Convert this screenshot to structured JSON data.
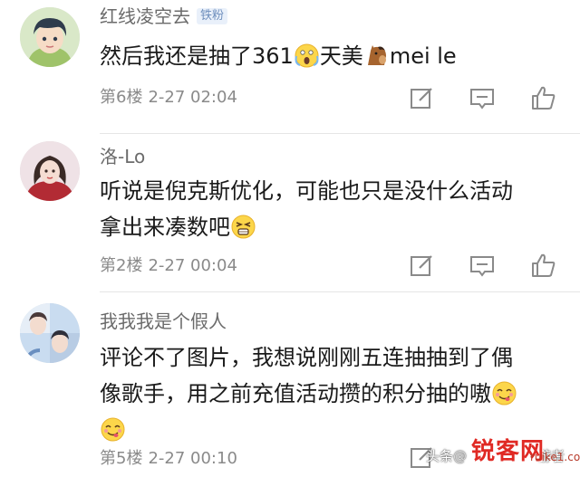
{
  "comments": [
    {
      "username": "红线凌空去",
      "badge": "铁粉",
      "text_parts": [
        "然后我还是抽了361",
        "天美",
        "mei le"
      ],
      "floor": "第6楼",
      "time": "2-27 02:04",
      "emojis": [
        "scream-emoji",
        "horse-emoji"
      ]
    },
    {
      "username": "洛-Lo",
      "text_line1": "听说是倪克斯优化，可能也只是没什么活动",
      "text_line2": "拿出来凑数吧",
      "floor": "第2楼",
      "time": "2-27 00:04",
      "emojis": [
        "wince-emoji"
      ]
    },
    {
      "username": "我我我是个假人",
      "text_line1": "评论不了图片，我想说刚刚五连抽抽到了偶",
      "text_line2": "像歌手，用之前充值活动攒的积分抽的嗷",
      "floor": "第5楼",
      "time": "2-27 00:10",
      "emojis": [
        "yum-emoji",
        "yum-emoji"
      ]
    }
  ],
  "actions": [
    "edit-icon",
    "comment-icon",
    "thumbs-up-icon"
  ],
  "watermark": {
    "source": "头条",
    "separator": "@",
    "author_tail": "游者",
    "logo": "锐客网",
    "site": "ruike1.com"
  },
  "colors": {
    "username": "#6b6b6b",
    "text": "#1a1a1a",
    "meta": "#8a8a8a",
    "badge_bg": "#e9f0fa",
    "badge_text": "#6f8fbd",
    "icon": "#8a8a8a",
    "logo": "#e02a24"
  }
}
